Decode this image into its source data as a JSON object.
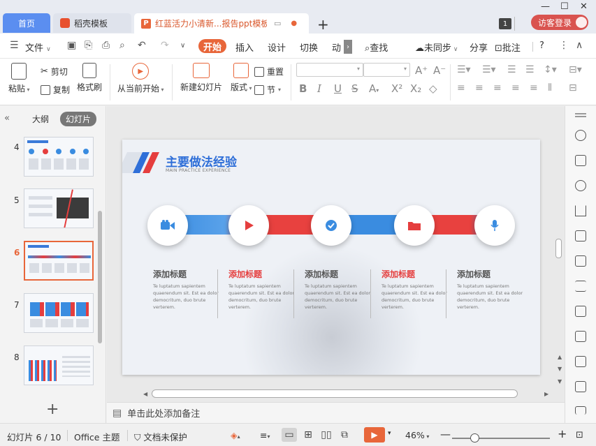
{
  "titlebar": {
    "home_tab": "首页",
    "docer_tab": "稻壳模板",
    "doc_tab": "红蓝活力小清新...报告ppt模板",
    "new_tab": "+",
    "window_count": "1",
    "guest_login": "访客登录"
  },
  "menubar": {
    "file": "文件",
    "start": "开始",
    "insert": "插入",
    "design": "设计",
    "transition": "切换",
    "animation": "动",
    "search": "查找",
    "sync": "未同步",
    "share": "分享",
    "comment": "批注",
    "help": "?"
  },
  "ribbon": {
    "paste": "粘贴",
    "cut": "剪切",
    "copy": "复制",
    "format_painter": "格式刷",
    "from_current": "从当前开始",
    "new_slide": "新建幻灯片",
    "layout": "版式",
    "reset": "重置",
    "section": "节"
  },
  "leftpanel": {
    "outline_tab": "大纲",
    "slides_tab": "幻灯片",
    "thumbnails": [
      {
        "num": "4"
      },
      {
        "num": "5"
      },
      {
        "num": "6"
      },
      {
        "num": "7"
      },
      {
        "num": "8"
      }
    ],
    "active_slide": "6",
    "add": "+"
  },
  "slide": {
    "title": "主要做法经验",
    "subtitle": "MAIN PRACTICE EXPERIENCE",
    "columns": [
      {
        "title": "添加标题",
        "text": "Te luptatum sapientem quaerendum sit. Est ea dolor democritum, duo brute verterem.",
        "icon": "video-camera-icon",
        "color": "#3a8ce0",
        "highlight": false
      },
      {
        "title": "添加标题",
        "text": "Te luptatum sapientem quaerendum sit. Est ea dolor democritum, duo brute verterem.",
        "icon": "play-icon",
        "color": "#e53e3e",
        "highlight": true
      },
      {
        "title": "添加标题",
        "text": "Te luptatum sapientem quaerendum sit. Est ea dolor democritum, duo brute verterem.",
        "icon": "check-icon",
        "color": "#3a8ce0",
        "highlight": false
      },
      {
        "title": "添加标题",
        "text": "Te luptatum sapientem quaerendum sit. Est ea dolor democritum, duo brute verterem.",
        "icon": "folder-icon",
        "color": "#e53e3e",
        "highlight": true
      },
      {
        "title": "添加标题",
        "text": "Te luptatum sapientem quaerendum sit. Est ea dolor democritum, duo brute verterem.",
        "icon": "microphone-icon",
        "color": "#3a8ce0",
        "highlight": false
      }
    ]
  },
  "notes": {
    "placeholder": "单击此处添加备注"
  },
  "statusbar": {
    "slide_counter": "幻灯片 6 / 10",
    "theme": "Office 主题",
    "protection": "文档未保护",
    "zoom": "46%",
    "zoom_level": 0.46
  },
  "colors": {
    "accent": "#e8663a",
    "blue": "#2f6fd8",
    "red": "#e53e3e"
  }
}
